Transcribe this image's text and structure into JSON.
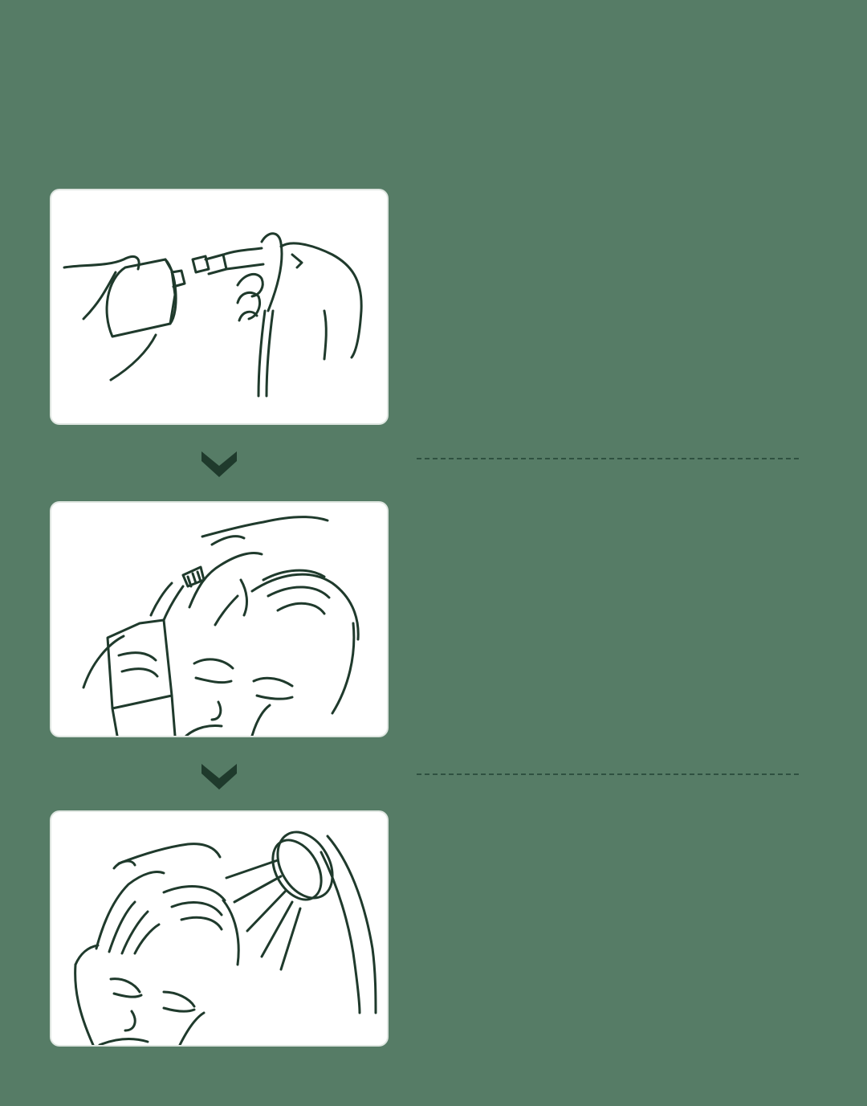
{
  "steps": [
    {
      "illustration": "apply-tube-nozzle-icon"
    },
    {
      "illustration": "apply-to-scalp-icon"
    },
    {
      "illustration": "rinse-shower-icon"
    }
  ],
  "colors": {
    "background": "#567c66",
    "card": "#ffffff",
    "line": "#1f3a2c"
  }
}
